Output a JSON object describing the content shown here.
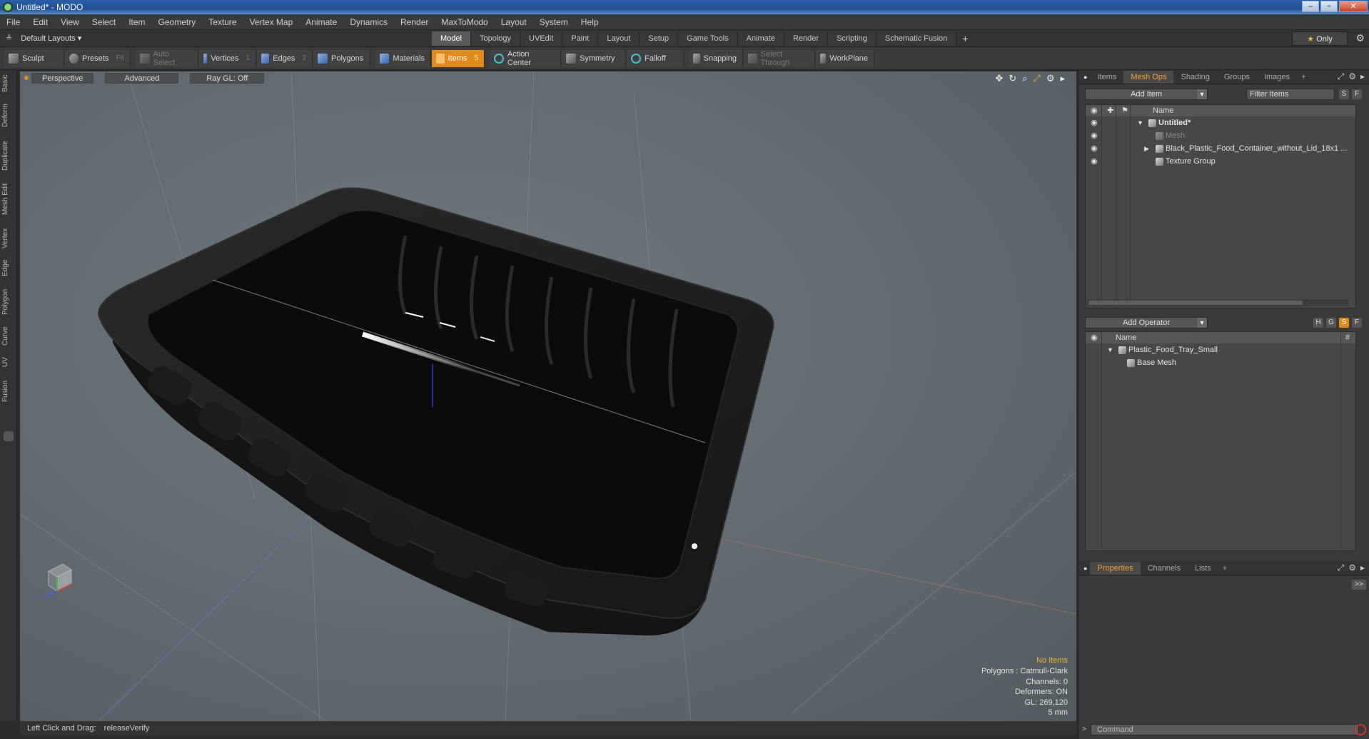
{
  "window": {
    "title": "Untitled* - MODO",
    "buttons": [
      "–",
      "▫",
      "✕"
    ]
  },
  "menu": [
    "File",
    "Edit",
    "View",
    "Select",
    "Item",
    "Geometry",
    "Texture",
    "Vertex Map",
    "Animate",
    "Dynamics",
    "Render",
    "MaxToModo",
    "Layout",
    "System",
    "Help"
  ],
  "layout_bar": {
    "layout_dropdown": "Default Layouts ▾",
    "tabs": [
      "Model",
      "Topology",
      "UVEdit",
      "Paint",
      "Layout",
      "Setup",
      "Game Tools",
      "Animate",
      "Render",
      "Scripting",
      "Schematic Fusion"
    ],
    "active_tab": "Model",
    "only_label": "Only"
  },
  "toolbar": {
    "sculpt": "Sculpt",
    "presets": "Presets",
    "presets_key": "F6",
    "auto_select": "Auto Select",
    "vertices": "Vertices",
    "vertices_key": "1",
    "edges": "Edges",
    "edges_key": "2",
    "polygons": "Polygons",
    "materials": "Materials",
    "items": "Items",
    "items_key": "5",
    "action_center": "Action Center",
    "symmetry": "Symmetry",
    "falloff": "Falloff",
    "snapping": "Snapping",
    "select_through": "Select Through",
    "workplane": "WorkPlane"
  },
  "left_tabs": [
    "Basic",
    "Deform",
    "Duplicate",
    "Mesh Edit",
    "Vertex",
    "Edge",
    "Polygon",
    "Curve",
    "UV",
    "Fusion"
  ],
  "viewport": {
    "view_mode": "Perspective",
    "shading": "Advanced",
    "raygl": "Ray GL: Off",
    "info": {
      "selection": "No Items",
      "polygons": "Polygons : Catmull-Clark",
      "channels": "Channels: 0",
      "deformers": "Deformers: ON",
      "gl": "GL: 269,120",
      "scale": "5 mm"
    }
  },
  "status_bar": {
    "label": "Left Click and Drag:",
    "value": "releaseVerify"
  },
  "item_panel": {
    "tabs": [
      "Items",
      "Mesh Ops",
      "Shading",
      "Groups",
      "Images"
    ],
    "active_tab": "Mesh Ops",
    "add_item": "Add Item",
    "filter_placeholder": "Filter Items",
    "s_btn": "S",
    "f_btn": "F",
    "header_name": "Name",
    "rows": [
      {
        "label": "Untitled*"
      },
      {
        "label": "Mesh"
      },
      {
        "label": "Black_Plastic_Food_Container_without_Lid_18x1 ..."
      },
      {
        "label": "Texture Group"
      }
    ]
  },
  "ops_panel": {
    "add_operator": "Add Operator",
    "h_btn": "H",
    "g_btn": "G",
    "s_btn": "S",
    "f_btn": "F",
    "header_name": "Name",
    "header_hash": "#",
    "rows": [
      {
        "label": "Plastic_Food_Tray_Small"
      },
      {
        "label": "Base Mesh"
      }
    ]
  },
  "bottom_panel": {
    "tabs": [
      "Properties",
      "Channels",
      "Lists"
    ],
    "active_tab": "Properties",
    "expand": ">>",
    "command_placeholder": "Command"
  }
}
